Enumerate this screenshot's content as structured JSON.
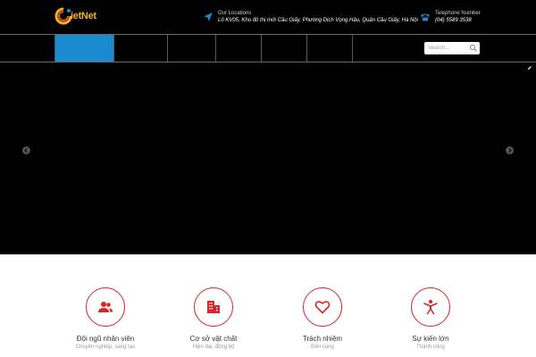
{
  "brand": {
    "logo_text": "ietNet",
    "accent": "#f6b21a",
    "red": "#d9242b",
    "blue": "#1a8bd0"
  },
  "header": {
    "location": {
      "icon": "location-arrow-icon",
      "label": "Our Locations",
      "value": "Lô KV05, Khu đô thị mới Cầu Giấy, Phường Dịch Vọng Hậu, Quận Cầu Giấy, Hà Nội"
    },
    "telephone": {
      "icon": "telephone-icon",
      "label": "Telephone Number",
      "value": "(04) 5589 3538"
    }
  },
  "nav": {
    "active_index": 0,
    "search": {
      "placeholder": "Search...",
      "icon": "search-icon"
    }
  },
  "slider": {
    "prev_icon": "chevron-left-icon",
    "next_icon": "chevron-right-icon"
  },
  "features": [
    {
      "icon": "users-icon",
      "title": "Đội ngũ nhân viên",
      "subtitle": "Chuyên nghiệp, sáng tạo"
    },
    {
      "icon": "building-icon",
      "title": "Cơ sở vật chất",
      "subtitle": "Hiện đại, đồng bộ"
    },
    {
      "icon": "heart-icon",
      "title": "Trách nhiệm",
      "subtitle": "Đến cùng"
    },
    {
      "icon": "person-icon",
      "title": "Sự kiến lớn",
      "subtitle": "Thành công"
    }
  ]
}
